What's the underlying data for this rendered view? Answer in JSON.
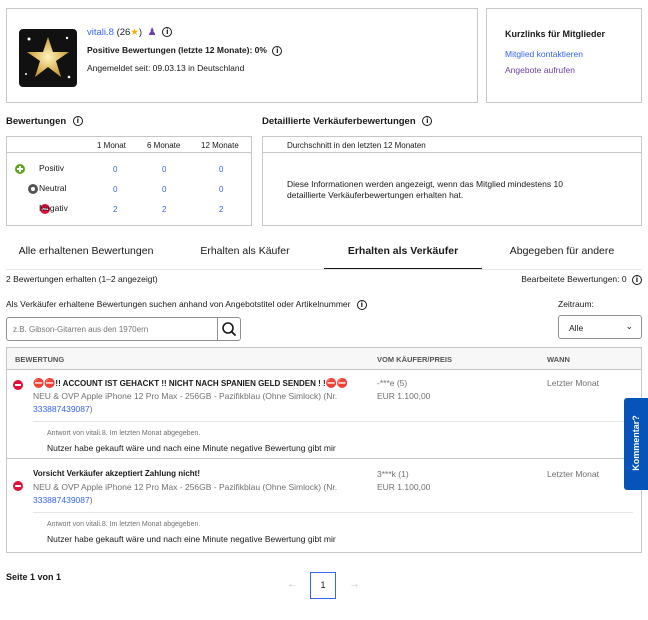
{
  "profile": {
    "username": "vitali.8",
    "score": "(26",
    "score_close": ")",
    "positive_label": "Positive Bewertungen (letzte 12 Monate): 0%",
    "member_since": "Angemeldet seit: 09.03.13 in Deutschland"
  },
  "shortcuts": {
    "title": "Kurzlinks für Mitglieder",
    "contact": "Mitglied kontaktieren",
    "offers": "Angebote aufrufen"
  },
  "ratings": {
    "title": "Bewertungen",
    "columns": [
      "1 Monat",
      "6 Monate",
      "12 Monate"
    ],
    "rows": [
      {
        "label": "Positiv",
        "values": [
          "0",
          "0",
          "0"
        ]
      },
      {
        "label": "Neutral",
        "values": [
          "0",
          "0",
          "0"
        ]
      },
      {
        "label": "Negativ",
        "values": [
          "2",
          "2",
          "2"
        ]
      }
    ]
  },
  "detailed": {
    "title": "Detaillierte Verkäuferbewertungen",
    "header": "Durchschnitt in den letzten 12 Monaten",
    "message": "Diese Informationen werden angezeigt, wenn das Mitglied mindestens 10 detaillierte Verkäuferbewertungen erhalten hat."
  },
  "tabs": [
    "Alle erhaltenen Bewertungen",
    "Erhalten als Käufer",
    "Erhalten als Verkäufer",
    "Abgegeben für andere"
  ],
  "summary": {
    "count": "2 Bewertungen erhalten (1–2 angezeigt)",
    "edited": "Bearbeitete Bewertungen: 0"
  },
  "search": {
    "label": "Als Verkäufer erhaltene Bewertungen suchen anhand von Angebotstitel oder Artikelnummer",
    "placeholder": "z.B. Gibson-Gitarren aus den 1970ern",
    "period_label": "Zeitraum:",
    "period_value": "Alle"
  },
  "table": {
    "headers": [
      "BEWERTUNG",
      "VOM KÄUFER/PREIS",
      "WANN"
    ],
    "rows": [
      {
        "title": "!! ACCOUNT IST GEHACKT !! NICHT NACH SPANIEN GELD SENDEN ! !",
        "item": "NEU & OVP Apple iPhone 12 Pro Max - 256GB - Pazifikblau (Ohne Simlock) (Nr.",
        "item_no": "333887439087",
        "item_close": ")",
        "buyer": "-***e (5)",
        "price": "EUR 1.100,00",
        "when": "Letzter Monat",
        "reply_meta": "Antwort von vitali.8. Im letzten Monat abgegeben.",
        "reply": "Nutzer habe gekauft wäre und nach eine Minute negative Bewertung gibt mir"
      },
      {
        "title": "Vorsicht Verkäufer akzeptiert Zahlung nicht!",
        "item": "NEU & OVP Apple iPhone 12 Pro Max - 256GB - Pazifikblau (Ohne Simlock) (Nr.",
        "item_no": "333887439087",
        "item_close": ")",
        "buyer": "3***k (1)",
        "price": "EUR 1.100,00",
        "when": "Letzter Monat",
        "reply_meta": "Antwort von vitali.8. Im letzten Monat abgegeben.",
        "reply": "Nutzer habe gekauft wäre und nach eine Minute negative Bewertung gibt mir"
      }
    ]
  },
  "pagination": {
    "label": "Seite 1 von 1",
    "current": "1"
  },
  "feedback_tab": "Kommentar?",
  "colors": {
    "link": "#3665f3",
    "negative": "#e0103a",
    "positive": "#5ba71b",
    "feedback": "#0654ba"
  }
}
